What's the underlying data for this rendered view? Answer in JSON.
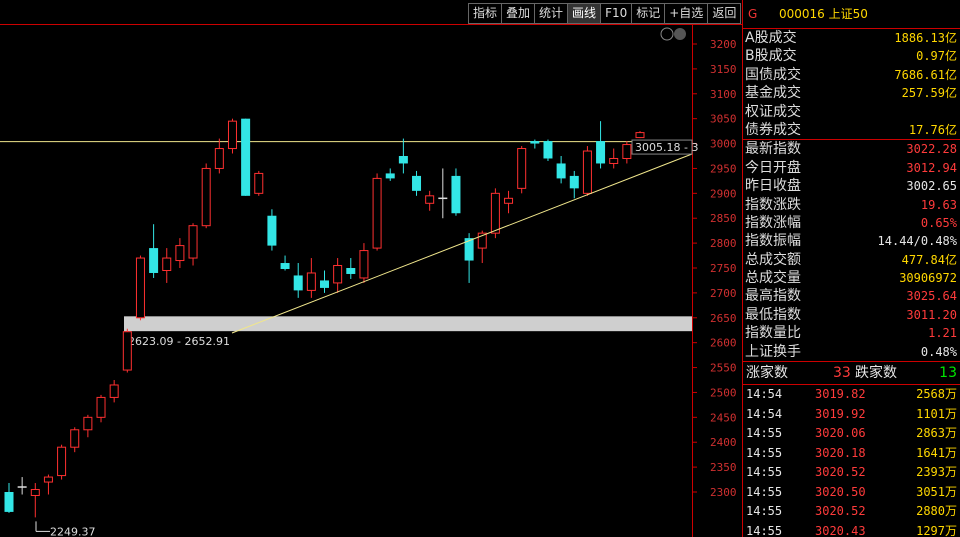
{
  "toolbar": {
    "buttons": [
      "指标",
      "叠加",
      "统计",
      "画线",
      "F10",
      "标记",
      "+自选",
      "返回"
    ]
  },
  "chart_data": {
    "type": "candlestick",
    "ylim": [
      2220,
      3230
    ],
    "y_ticks": [
      2300,
      2350,
      2400,
      2450,
      2500,
      2550,
      2600,
      2650,
      2700,
      2750,
      2800,
      2850,
      2900,
      2950,
      3000,
      3050,
      3100,
      3150,
      3200
    ],
    "resistance_level": 3004,
    "zone": {
      "low": 2623.09,
      "high": 2652.91,
      "label": "2623.09 - 2652.91"
    },
    "line_label": "3005.18 - 3",
    "low_marker": "2249.37",
    "candles": [
      {
        "o": 2300,
        "h": 2318,
        "l": 2258,
        "c": 2260,
        "dir": "down"
      },
      {
        "o": 2310,
        "h": 2330,
        "l": 2295,
        "c": 2310,
        "dir": "flat"
      },
      {
        "o": 2293,
        "h": 2318,
        "l": 2249,
        "c": 2305,
        "dir": "up"
      },
      {
        "o": 2320,
        "h": 2335,
        "l": 2295,
        "c": 2330,
        "dir": "up"
      },
      {
        "o": 2333,
        "h": 2395,
        "l": 2325,
        "c": 2390,
        "dir": "up"
      },
      {
        "o": 2390,
        "h": 2430,
        "l": 2380,
        "c": 2425,
        "dir": "up"
      },
      {
        "o": 2425,
        "h": 2455,
        "l": 2410,
        "c": 2450,
        "dir": "up"
      },
      {
        "o": 2450,
        "h": 2495,
        "l": 2440,
        "c": 2490,
        "dir": "up"
      },
      {
        "o": 2490,
        "h": 2525,
        "l": 2480,
        "c": 2515,
        "dir": "up"
      },
      {
        "o": 2545,
        "h": 2628,
        "l": 2540,
        "c": 2622,
        "dir": "up"
      },
      {
        "o": 2650,
        "h": 2775,
        "l": 2645,
        "c": 2770,
        "dir": "up"
      },
      {
        "o": 2790,
        "h": 2838,
        "l": 2730,
        "c": 2740,
        "dir": "down"
      },
      {
        "o": 2745,
        "h": 2790,
        "l": 2720,
        "c": 2770,
        "dir": "up"
      },
      {
        "o": 2765,
        "h": 2810,
        "l": 2750,
        "c": 2795,
        "dir": "up"
      },
      {
        "o": 2770,
        "h": 2840,
        "l": 2755,
        "c": 2835,
        "dir": "up"
      },
      {
        "o": 2835,
        "h": 2960,
        "l": 2830,
        "c": 2950,
        "dir": "up"
      },
      {
        "o": 2950,
        "h": 3010,
        "l": 2940,
        "c": 2990,
        "dir": "up"
      },
      {
        "o": 2990,
        "h": 3050,
        "l": 2980,
        "c": 3045,
        "dir": "up"
      },
      {
        "o": 3050,
        "h": 3050,
        "l": 2895,
        "c": 2895,
        "dir": "down"
      },
      {
        "o": 2900,
        "h": 2945,
        "l": 2895,
        "c": 2940,
        "dir": "up"
      },
      {
        "o": 2855,
        "h": 2868,
        "l": 2785,
        "c": 2795,
        "dir": "down"
      },
      {
        "o": 2760,
        "h": 2775,
        "l": 2745,
        "c": 2748,
        "dir": "down"
      },
      {
        "o": 2735,
        "h": 2760,
        "l": 2690,
        "c": 2705,
        "dir": "down"
      },
      {
        "o": 2705,
        "h": 2770,
        "l": 2690,
        "c": 2740,
        "dir": "up"
      },
      {
        "o": 2725,
        "h": 2745,
        "l": 2700,
        "c": 2710,
        "dir": "down"
      },
      {
        "o": 2720,
        "h": 2770,
        "l": 2700,
        "c": 2755,
        "dir": "up"
      },
      {
        "o": 2750,
        "h": 2770,
        "l": 2728,
        "c": 2738,
        "dir": "down"
      },
      {
        "o": 2730,
        "h": 2800,
        "l": 2720,
        "c": 2785,
        "dir": "up"
      },
      {
        "o": 2790,
        "h": 2940,
        "l": 2785,
        "c": 2930,
        "dir": "up"
      },
      {
        "o": 2940,
        "h": 2950,
        "l": 2925,
        "c": 2930,
        "dir": "down"
      },
      {
        "o": 2975,
        "h": 3010,
        "l": 2940,
        "c": 2960,
        "dir": "down"
      },
      {
        "o": 2935,
        "h": 2945,
        "l": 2895,
        "c": 2905,
        "dir": "down"
      },
      {
        "o": 2880,
        "h": 2905,
        "l": 2865,
        "c": 2895,
        "dir": "up"
      },
      {
        "o": 2890,
        "h": 2950,
        "l": 2850,
        "c": 2885,
        "dir": "flat"
      },
      {
        "o": 2935,
        "h": 2950,
        "l": 2855,
        "c": 2860,
        "dir": "down"
      },
      {
        "o": 2810,
        "h": 2820,
        "l": 2720,
        "c": 2765,
        "dir": "down"
      },
      {
        "o": 2790,
        "h": 2825,
        "l": 2760,
        "c": 2820,
        "dir": "up"
      },
      {
        "o": 2820,
        "h": 2910,
        "l": 2810,
        "c": 2900,
        "dir": "up"
      },
      {
        "o": 2880,
        "h": 2905,
        "l": 2860,
        "c": 2890,
        "dir": "up"
      },
      {
        "o": 2910,
        "h": 2995,
        "l": 2900,
        "c": 2990,
        "dir": "up"
      },
      {
        "o": 3005,
        "h": 3008,
        "l": 2990,
        "c": 3000,
        "dir": "down"
      },
      {
        "o": 3005,
        "h": 3008,
        "l": 2965,
        "c": 2970,
        "dir": "down"
      },
      {
        "o": 2960,
        "h": 2975,
        "l": 2920,
        "c": 2930,
        "dir": "down"
      },
      {
        "o": 2935,
        "h": 2945,
        "l": 2890,
        "c": 2910,
        "dir": "down"
      },
      {
        "o": 2900,
        "h": 2995,
        "l": 2895,
        "c": 2985,
        "dir": "up"
      },
      {
        "o": 3005,
        "h": 3045,
        "l": 2950,
        "c": 2960,
        "dir": "down"
      },
      {
        "o": 2960,
        "h": 2990,
        "l": 2950,
        "c": 2970,
        "dir": "up"
      },
      {
        "o": 2970,
        "h": 3005,
        "l": 2960,
        "c": 2998,
        "dir": "up"
      },
      {
        "o": 3012,
        "h": 3025,
        "l": 3011,
        "c": 3022,
        "dir": "up"
      }
    ]
  },
  "panel": {
    "g_label": "G",
    "code_name": "000016 上证50",
    "stats": [
      {
        "label": "A股成交",
        "value": "1886.13亿",
        "color": "y"
      },
      {
        "label": "B股成交",
        "value": "0.97亿",
        "color": "y"
      },
      {
        "label": "国债成交",
        "value": "7686.61亿",
        "color": "y"
      },
      {
        "label": "基金成交",
        "value": "257.59亿",
        "color": "y"
      },
      {
        "label": "权证成交",
        "value": "",
        "color": "y"
      },
      {
        "label": "债券成交",
        "value": "17.76亿",
        "color": "y"
      }
    ],
    "quote": [
      {
        "label": "最新指数",
        "value": "3022.28",
        "color": "r"
      },
      {
        "label": "今日开盘",
        "value": "3012.94",
        "color": "r"
      },
      {
        "label": "昨日收盘",
        "value": "3002.65",
        "color": "w"
      },
      {
        "label": "指数涨跌",
        "value": "19.63",
        "color": "r"
      },
      {
        "label": "指数涨幅",
        "value": "0.65%",
        "color": "r"
      },
      {
        "label": "指数振幅",
        "value": "14.44/0.48%",
        "color": "w"
      },
      {
        "label": "总成交额",
        "value": "477.84亿",
        "color": "y"
      },
      {
        "label": "总成交量",
        "value": "30906972",
        "color": "y"
      },
      {
        "label": "最高指数",
        "value": "3025.64",
        "color": "r"
      },
      {
        "label": "最低指数",
        "value": "3011.20",
        "color": "r"
      },
      {
        "label": "指数量比",
        "value": "1.21",
        "color": "r"
      },
      {
        "label": "上证换手",
        "value": "0.48%",
        "color": "w"
      }
    ],
    "breadth": {
      "up_label": "涨家数",
      "up_value": "33",
      "down_label": "跌家数",
      "down_value": "13"
    },
    "ticks": [
      {
        "time": "14:54",
        "price": "3019.82",
        "vol": "2568万"
      },
      {
        "time": "14:54",
        "price": "3019.92",
        "vol": "1101万"
      },
      {
        "time": "14:55",
        "price": "3020.06",
        "vol": "2863万"
      },
      {
        "time": "14:55",
        "price": "3020.18",
        "vol": "1641万"
      },
      {
        "time": "14:55",
        "price": "3020.52",
        "vol": "2393万"
      },
      {
        "time": "14:55",
        "price": "3020.50",
        "vol": "3051万"
      },
      {
        "time": "14:55",
        "price": "3020.52",
        "vol": "2880万"
      },
      {
        "time": "14:55",
        "price": "3020.43",
        "vol": "1297万"
      }
    ]
  }
}
